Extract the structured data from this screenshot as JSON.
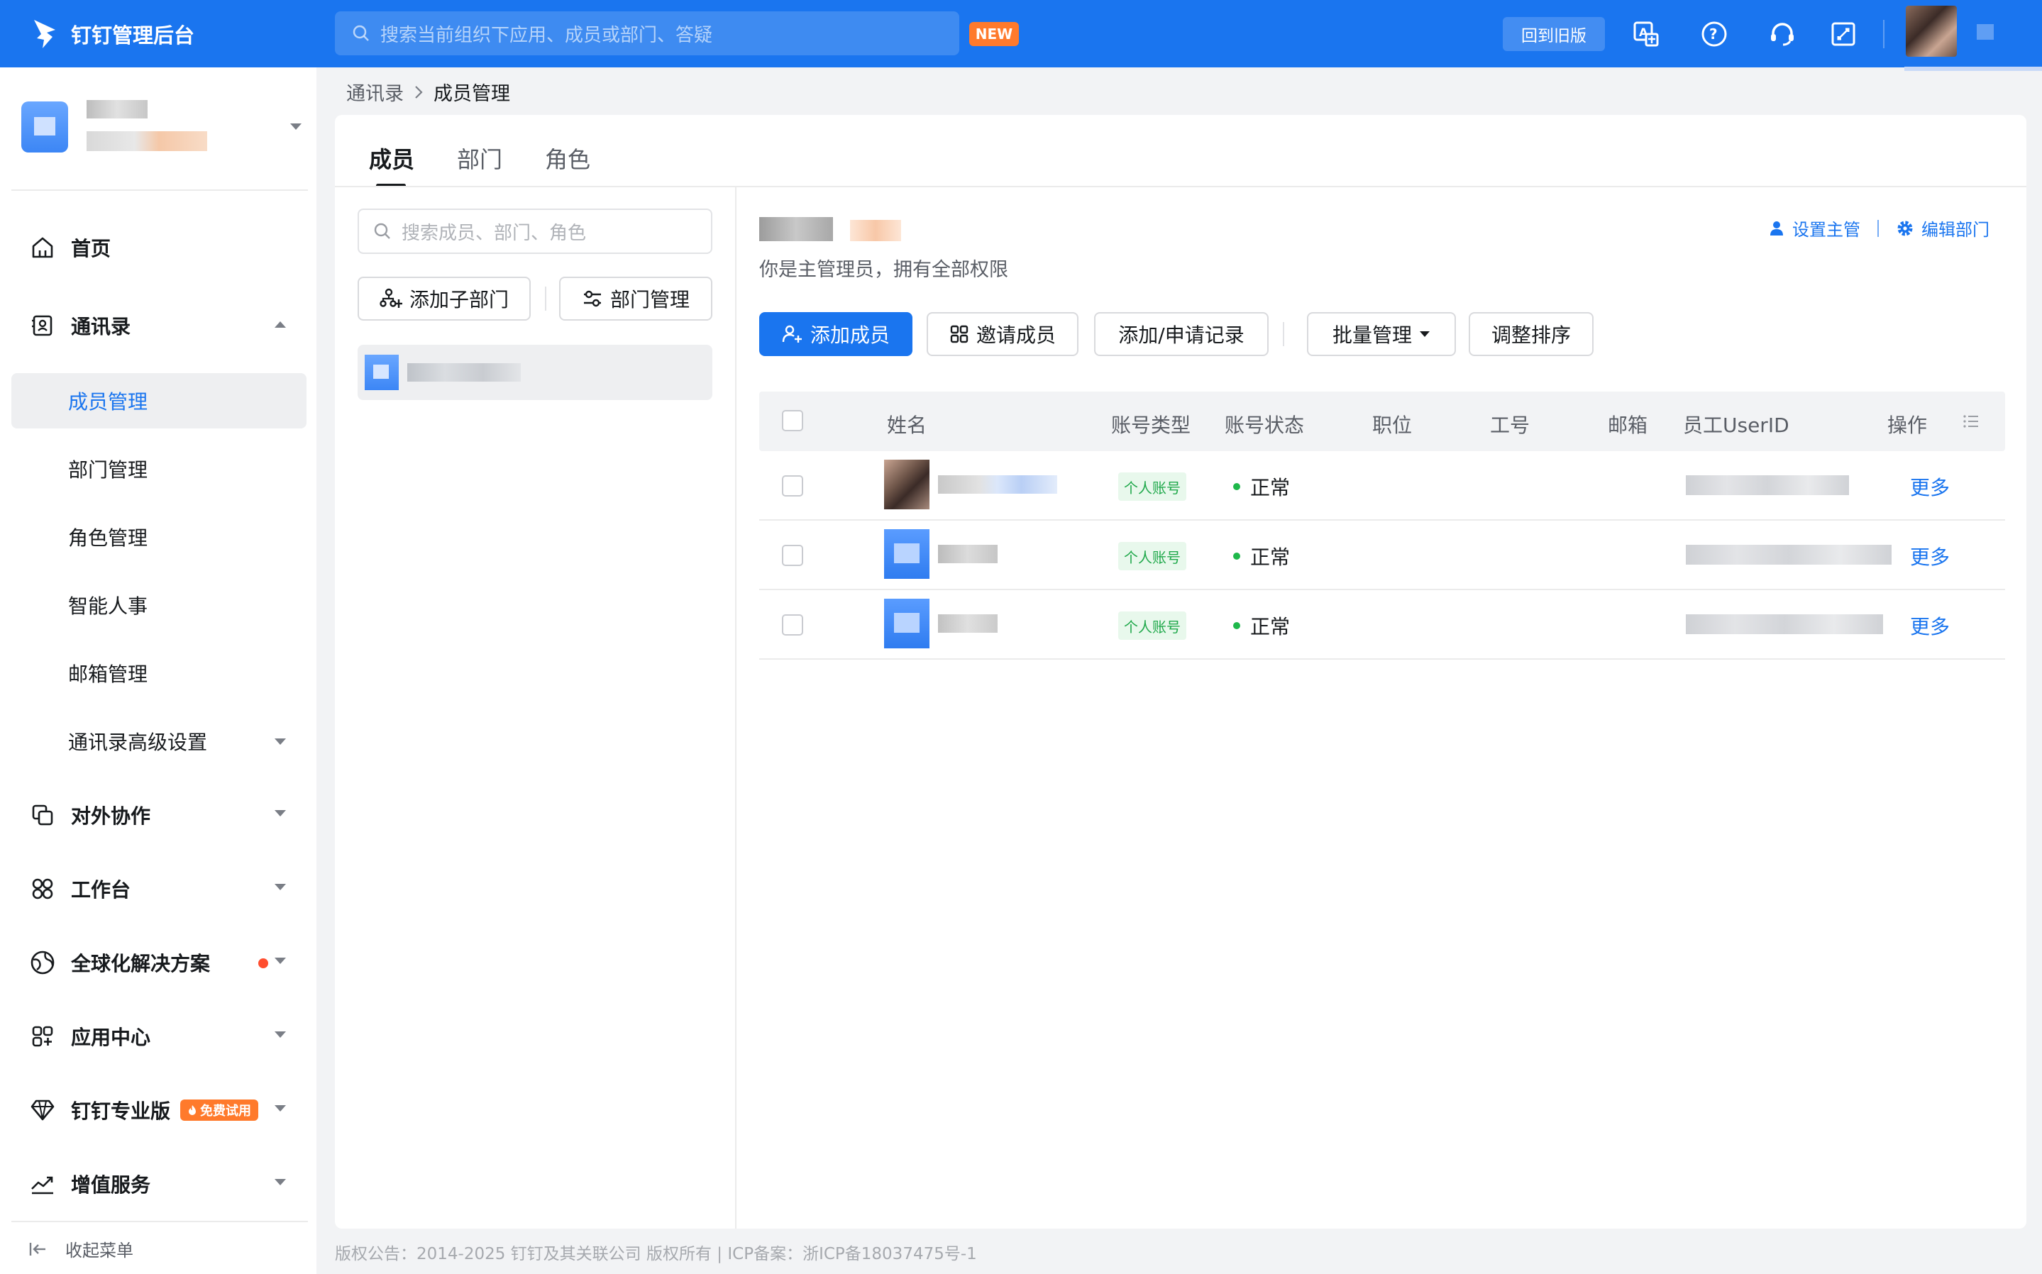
{
  "header": {
    "app_title": "钉钉管理后台",
    "search_placeholder": "搜索当前组织下应用、成员或部门、答疑",
    "new_badge": "NEW",
    "old_version_button": "回到旧版"
  },
  "sidebar": {
    "home": "首页",
    "contacts": "通讯录",
    "contacts_sub": [
      "成员管理",
      "部门管理",
      "角色管理",
      "智能人事",
      "邮箱管理",
      "通讯录高级设置"
    ],
    "external": "对外协作",
    "workbench": "工作台",
    "global": "全球化解决方案",
    "app_center": "应用中心",
    "pro": "钉钉专业版",
    "pro_badge": "免费试用",
    "value_added": "增值服务",
    "collapse": "收起菜单"
  },
  "breadcrumb": {
    "parent": "通讯录",
    "current": "成员管理"
  },
  "tabs": [
    "成员",
    "部门",
    "角色"
  ],
  "tree": {
    "search_placeholder": "搜索成员、部门、角色",
    "add_sub_dept": "添加子部门",
    "dept_manage": "部门管理"
  },
  "dept": {
    "admin_text": "你是主管理员，拥有全部权限",
    "set_manager": "设置主管",
    "edit_dept": "编辑部门"
  },
  "toolbar": {
    "add_member": "添加成员",
    "invite": "邀请成员",
    "records": "添加/申请记录",
    "batch": "批量管理",
    "sort": "调整排序"
  },
  "table": {
    "columns": [
      "姓名",
      "账号类型",
      "账号状态",
      "职位",
      "工号",
      "邮箱",
      "员工UserID",
      "操作"
    ],
    "rows": [
      {
        "account_type": "个人账号",
        "status": "正常",
        "action": "更多"
      },
      {
        "account_type": "个人账号",
        "status": "正常",
        "action": "更多"
      },
      {
        "account_type": "个人账号",
        "status": "正常",
        "action": "更多"
      }
    ]
  },
  "footer": "版权公告：2014-2025 钉钉及其关联公司 版权所有 | ICP备案：浙ICP备18037475号-1",
  "colors": {
    "primary": "#1a75ef",
    "topbar": "#1a75ef",
    "trial": "#ff7a2c",
    "status_ok": "#1fb84b"
  }
}
